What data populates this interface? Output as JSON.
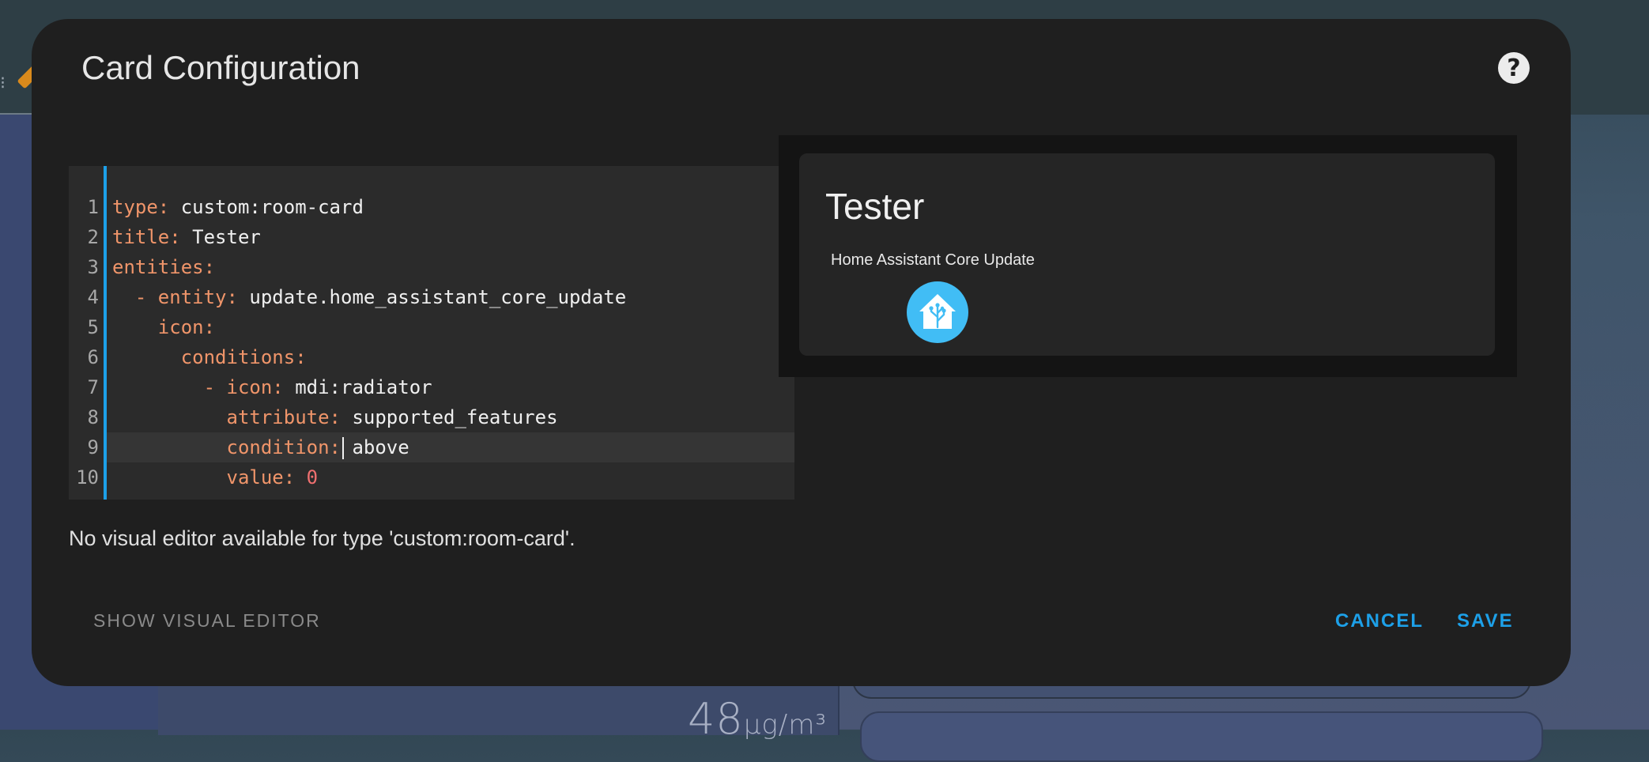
{
  "dialog": {
    "title": "Card Configuration",
    "help_icon": "help-circle-icon",
    "notice": "No visual editor available for type 'custom:room-card'.",
    "show_visual_editor_label": "SHOW VISUAL EDITOR",
    "cancel_label": "CANCEL",
    "save_label": "SAVE",
    "accent_color": "#1da0e8"
  },
  "editor": {
    "lines": [
      {
        "n": "1",
        "key": "type:",
        "value": " custom:room-card"
      },
      {
        "n": "2",
        "key": "title:",
        "value": " Tester"
      },
      {
        "n": "3",
        "key": "entities:",
        "value": ""
      },
      {
        "n": "4",
        "key": "  - entity:",
        "value": " update.home_assistant_core_update"
      },
      {
        "n": "5",
        "key": "    icon:",
        "value": ""
      },
      {
        "n": "6",
        "key": "      conditions:",
        "value": ""
      },
      {
        "n": "7",
        "key": "        - icon:",
        "value": " mdi:radiator"
      },
      {
        "n": "8",
        "key": "          attribute:",
        "value": " supported_features"
      },
      {
        "n": "9",
        "key": "condition:",
        "value": " above"
      },
      {
        "n": "10",
        "key": "          value:",
        "value": " 0"
      }
    ]
  },
  "preview": {
    "title": "Tester",
    "entity_name": "Home Assistant Core Update",
    "entity_icon": "home-assistant-icon",
    "icon_color": "#41bdf5"
  },
  "background": {
    "big_number": "48",
    "big_unit": "µg/m³"
  }
}
